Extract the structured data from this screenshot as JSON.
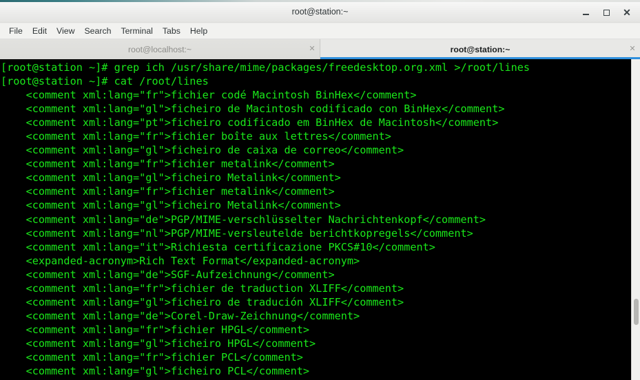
{
  "window": {
    "title": "root@station:~",
    "controls": {
      "minimize": "minimize-button",
      "maximize": "maximize-button",
      "close": "close-button"
    }
  },
  "menubar": {
    "items": [
      {
        "label": "File"
      },
      {
        "label": "Edit"
      },
      {
        "label": "View"
      },
      {
        "label": "Search"
      },
      {
        "label": "Terminal"
      },
      {
        "label": "Tabs"
      },
      {
        "label": "Help"
      }
    ]
  },
  "tabs": {
    "active_index": 1,
    "close_glyph": "✕",
    "items": [
      {
        "label": "root@localhost:~",
        "active": false
      },
      {
        "label": "root@station:~",
        "active": true
      }
    ]
  },
  "terminal": {
    "foreground_color": "#1ae81a",
    "background_color": "#000000",
    "lines": [
      "[root@station ~]# grep ich /usr/share/mime/packages/freedesktop.org.xml >/root/lines",
      "[root@station ~]# cat /root/lines",
      "    <comment xml:lang=\"fr\">fichier codé Macintosh BinHex</comment>",
      "    <comment xml:lang=\"gl\">ficheiro de Macintosh codificado con BinHex</comment>",
      "    <comment xml:lang=\"pt\">ficheiro codificado em BinHex de Macintosh</comment>",
      "    <comment xml:lang=\"fr\">fichier boîte aux lettres</comment>",
      "    <comment xml:lang=\"gl\">ficheiro de caixa de correo</comment>",
      "    <comment xml:lang=\"fr\">fichier metalink</comment>",
      "    <comment xml:lang=\"gl\">ficheiro Metalink</comment>",
      "    <comment xml:lang=\"fr\">fichier metalink</comment>",
      "    <comment xml:lang=\"gl\">ficheiro Metalink</comment>",
      "    <comment xml:lang=\"de\">PGP/MIME-verschlüsselter Nachrichtenkopf</comment>",
      "    <comment xml:lang=\"nl\">PGP/MIME-versleutelde berichtkopregels</comment>",
      "    <comment xml:lang=\"it\">Richiesta certificazione PKCS#10</comment>",
      "    <expanded-acronym>Rich Text Format</expanded-acronym>",
      "    <comment xml:lang=\"de\">SGF-Aufzeichnung</comment>",
      "    <comment xml:lang=\"fr\">fichier de traduction XLIFF</comment>",
      "    <comment xml:lang=\"gl\">ficheiro de tradución XLIFF</comment>",
      "    <comment xml:lang=\"de\">Corel-Draw-Zeichnung</comment>",
      "    <comment xml:lang=\"fr\">fichier HPGL</comment>",
      "    <comment xml:lang=\"gl\">ficheiro HPGL</comment>",
      "    <comment xml:lang=\"fr\">fichier PCL</comment>",
      "    <comment xml:lang=\"gl\">ficheiro PCL</comment>"
    ]
  }
}
